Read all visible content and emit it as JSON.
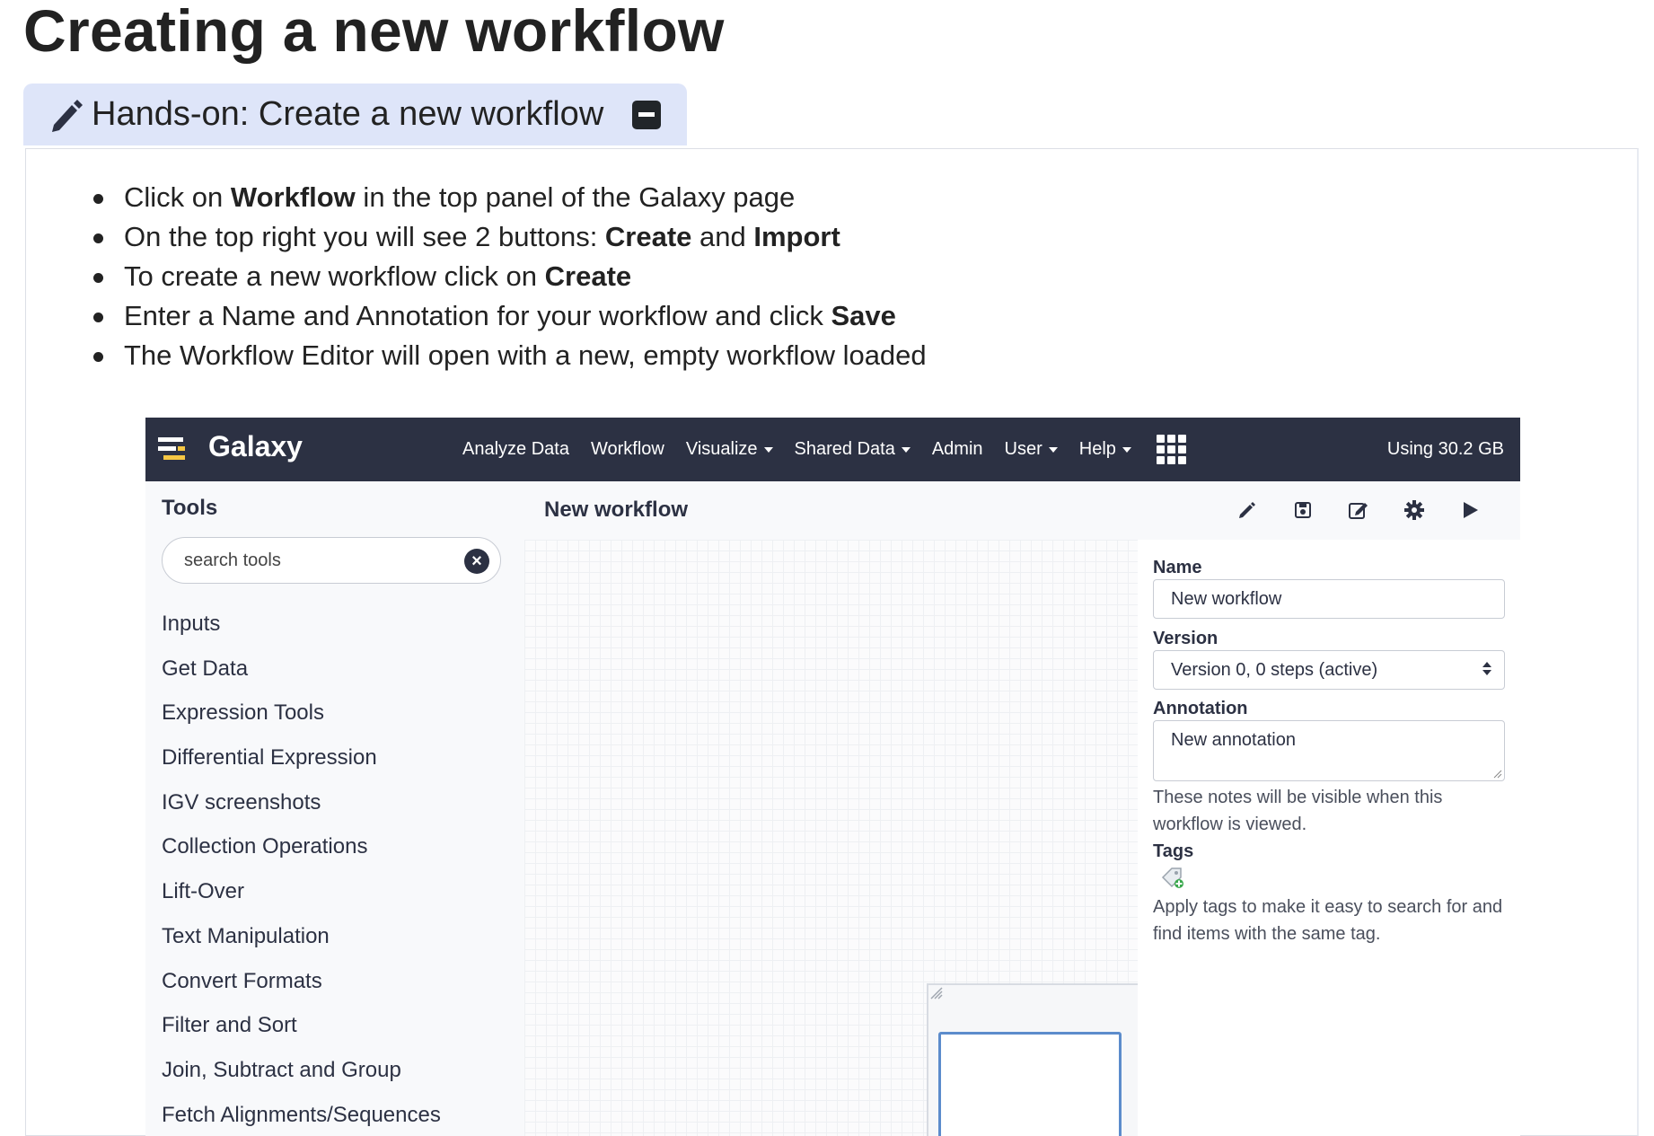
{
  "page": {
    "title": "Creating a new workflow"
  },
  "handson": {
    "title": "Hands-on: Create a new workflow",
    "steps": [
      {
        "pre": "Click on ",
        "bold": "Workflow",
        "mid": " in the top panel of the Galaxy page",
        "bold2": "",
        "post": ""
      },
      {
        "pre": "On the top right you will see 2 buttons: ",
        "bold": "Create",
        "mid": " and ",
        "bold2": "Import",
        "post": ""
      },
      {
        "pre": "To create a new workflow click on ",
        "bold": "Create",
        "mid": "",
        "bold2": "",
        "post": ""
      },
      {
        "pre": "Enter a Name and Annotation for your workflow and click ",
        "bold": "Save",
        "mid": "",
        "bold2": "",
        "post": ""
      },
      {
        "pre": "The Workflow Editor will open with a new, empty workflow loaded",
        "bold": "",
        "mid": "",
        "bold2": "",
        "post": ""
      }
    ]
  },
  "galaxy": {
    "brand": "Galaxy",
    "nav": [
      "Analyze Data",
      "Workflow",
      "Visualize",
      "Shared Data",
      "Admin",
      "User",
      "Help"
    ],
    "quota": "Using 30.2 GB",
    "tools": {
      "title": "Tools",
      "search_placeholder": "search tools",
      "sections": [
        "Inputs",
        "Get Data",
        "Expression Tools",
        "Differential Expression",
        "IGV screenshots",
        "Collection Operations",
        "Lift-Over",
        "Text Manipulation",
        "Convert Formats",
        "Filter and Sort",
        "Join, Subtract and Group",
        "Fetch Alignments/Sequences"
      ]
    },
    "editor": {
      "title": "New workflow",
      "toolbar_icons": [
        "pencil-icon",
        "save-icon",
        "edit-icon",
        "gear-icon",
        "play-icon"
      ]
    },
    "attributes": {
      "name_label": "Name",
      "name_value": "New workflow",
      "version_label": "Version",
      "version_value": "Version 0, 0 steps (active)",
      "annotation_label": "Annotation",
      "annotation_value": "New annotation",
      "annotation_help": "These notes will be visible when this workflow is viewed.",
      "tags_label": "Tags",
      "tags_help": "Apply tags to make it easy to search for and find items with the same tag."
    }
  },
  "colors": {
    "masthead": "#2c3143",
    "handson_header": "#dee5f9",
    "overview_border": "#5c8ccc"
  }
}
